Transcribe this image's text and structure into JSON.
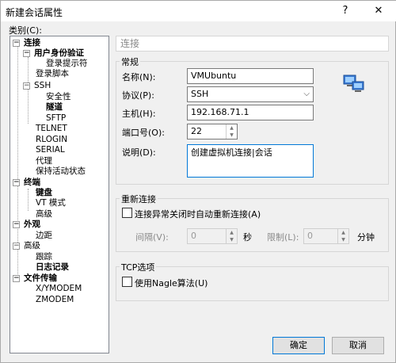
{
  "window": {
    "title": "新建会话属性",
    "help": "?",
    "close": "✕"
  },
  "category_label": "类别(C):",
  "tree": [
    {
      "label": "连接",
      "bold": true,
      "expander": "−"
    },
    {
      "label": "用户身份验证",
      "bold": true,
      "expander": "−"
    },
    {
      "label": "登录提示符",
      "bold": false
    },
    {
      "label": "登录脚本",
      "bold": false
    },
    {
      "label": "SSH",
      "bold": false,
      "expander": "−"
    },
    {
      "label": "安全性",
      "bold": false
    },
    {
      "label": "隧道",
      "bold": true
    },
    {
      "label": "SFTP",
      "bold": false
    },
    {
      "label": "TELNET",
      "bold": false
    },
    {
      "label": "RLOGIN",
      "bold": false
    },
    {
      "label": "SERIAL",
      "bold": false
    },
    {
      "label": "代理",
      "bold": false
    },
    {
      "label": "保持活动状态",
      "bold": false
    },
    {
      "label": "终端",
      "bold": true,
      "expander": "−"
    },
    {
      "label": "键盘",
      "bold": true
    },
    {
      "label": "VT 模式",
      "bold": false
    },
    {
      "label": "高级",
      "bold": false
    },
    {
      "label": "外观",
      "bold": true,
      "expander": "−"
    },
    {
      "label": "边距",
      "bold": false
    },
    {
      "label": "高级",
      "bold": false,
      "expander": "−"
    },
    {
      "label": "跟踪",
      "bold": false
    },
    {
      "label": "日志记录",
      "bold": true
    },
    {
      "label": "文件传输",
      "bold": true,
      "expander": "−"
    },
    {
      "label": "X/YMODEM",
      "bold": false
    },
    {
      "label": "ZMODEM",
      "bold": false
    }
  ],
  "panel": {
    "header": "连接",
    "general": {
      "title": "常规",
      "name_label": "名称(N):",
      "name_value": "VMUbuntu",
      "protocol_label": "协议(P):",
      "protocol_value": "SSH",
      "host_label": "主机(H):",
      "host_value": "192.168.71.1",
      "port_label": "端口号(O):",
      "port_value": "22",
      "desc_label": "说明(D):",
      "desc_value": "创建虚拟机连接|会话"
    },
    "reconnect": {
      "title": "重新连接",
      "auto_reconnect_label": "连接异常关闭时自动重新连接(A)",
      "interval_label": "间隔(V):",
      "interval_value": "0",
      "interval_unit": "秒",
      "limit_label": "限制(L):",
      "limit_value": "0",
      "limit_unit": "分钟"
    },
    "tcp": {
      "title": "TCP选项",
      "nagle_label": "使用Nagle算法(U)"
    }
  },
  "buttons": {
    "ok": "确定",
    "cancel": "取消"
  },
  "icons": {
    "network": "network-computer-icon",
    "dropdown": "chevron-down-icon"
  }
}
